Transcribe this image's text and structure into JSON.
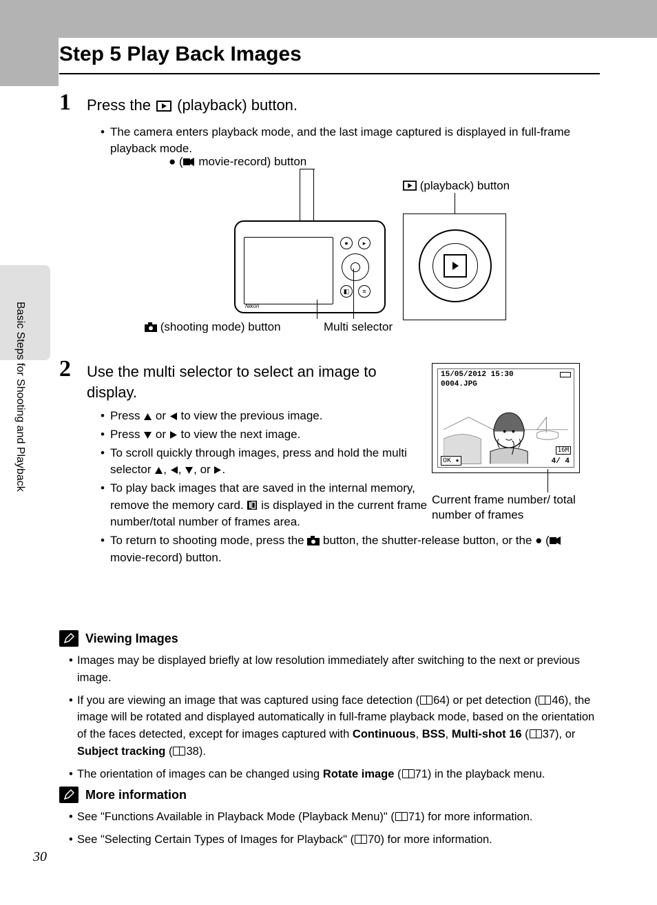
{
  "page_number": "30",
  "side_label": "Basic Steps for Shooting and Playback",
  "heading": "Step 5 Play Back Images",
  "step1": {
    "num": "1",
    "title_before": "Press the ",
    "title_after": " (playback) button.",
    "bullet1": "The camera enters playback mode, and the last image captured is displayed in full-frame playback mode."
  },
  "diagram": {
    "movie_label_before": "● (",
    "movie_label_after": " movie-record) button",
    "playback_label": "(playback) button",
    "shoot_label": "(shooting mode) button",
    "multi_label": "Multi selector",
    "brand": "Nikon"
  },
  "step2": {
    "num": "2",
    "title": "Use the multi selector to select an image to display.",
    "b1_a": "Press ",
    "b1_b": " or ",
    "b1_c": " to view the previous image.",
    "b2_a": "Press ",
    "b2_b": " or ",
    "b2_c": " to view the next image.",
    "b3_a": "To scroll quickly through images, press and hold the multi selector ",
    "b3_sep": ", ",
    "b3_or": ", or ",
    "b3_end": ".",
    "b4_a": "To play back images that are saved in the internal memory, remove the memory card. ",
    "b4_b": " is displayed in the current frame number/total number of frames area.",
    "b5_a": "To return to shooting mode, press the ",
    "b5_b": " button, the shutter-release button, or the ● (",
    "b5_c": " movie-record) button."
  },
  "lcd": {
    "timestamp": "15/05/2012 15:30",
    "filename": "0004.JPG",
    "ok": "OK",
    "size": "16M",
    "counter": "4/    4",
    "caption": "Current frame number/ total number of frames"
  },
  "note1": {
    "title": "Viewing Images",
    "b1": "Images may be displayed briefly at low resolution immediately after switching to the next or previous image.",
    "b2_a": "If you are viewing an image that was captured using face detection (",
    "b2_p1": "64) or pet detection (",
    "b2_p2": "46), the image will be rotated and displayed automatically in full-frame playback mode, based on the orientation of the faces detected, except for images captured with ",
    "b2_cont": "Continuous",
    "b2_c1": ", ",
    "b2_bss": "BSS",
    "b2_c2": ", ",
    "b2_ms": "Multi-shot 16",
    "b2_open3": " (",
    "b2_p3": "37), or ",
    "b2_st": "Subject tracking",
    "b2_open4": " (",
    "b2_p4": "38).",
    "b3_a": "The orientation of images can be changed using ",
    "b3_ri": "Rotate image",
    "b3_b": " (",
    "b3_p": "71) in the playback menu."
  },
  "note2": {
    "title": "More information",
    "b1_a": "See \"Functions Available in Playback Mode (Playback Menu)\" (",
    "b1_b": "71) for more information.",
    "b2_a": "See \"Selecting Certain Types of Images for Playback\" (",
    "b2_b": "70) for more information."
  }
}
